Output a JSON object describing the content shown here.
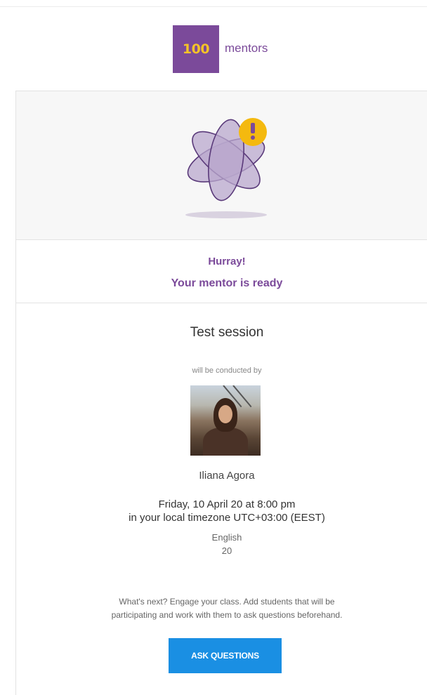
{
  "brand": {
    "logo_number": "100",
    "logo_word": "mentors",
    "color": "#7b4a9a",
    "accent": "#f4c328"
  },
  "hero": {
    "icon": "atom-alert-icon"
  },
  "headline": {
    "line1": "Hurray!",
    "line2": "Your mentor is ready"
  },
  "session": {
    "title": "Test session",
    "conducted_by_label": "will be conducted by",
    "mentor_name": "Iliana Agora",
    "datetime_line1": "Friday, 10 April 20 at 8:00 pm",
    "datetime_line2": "in your local timezone UTC+03:00 (EEST)",
    "language": "English",
    "seats": "20"
  },
  "next_steps": {
    "line1": "What's next? Engage your class. Add students that will be",
    "line2": "participating and work with them to ask questions beforehand."
  },
  "cta": {
    "label": "ASK QUESTIONS",
    "color": "#1a8fe3"
  }
}
